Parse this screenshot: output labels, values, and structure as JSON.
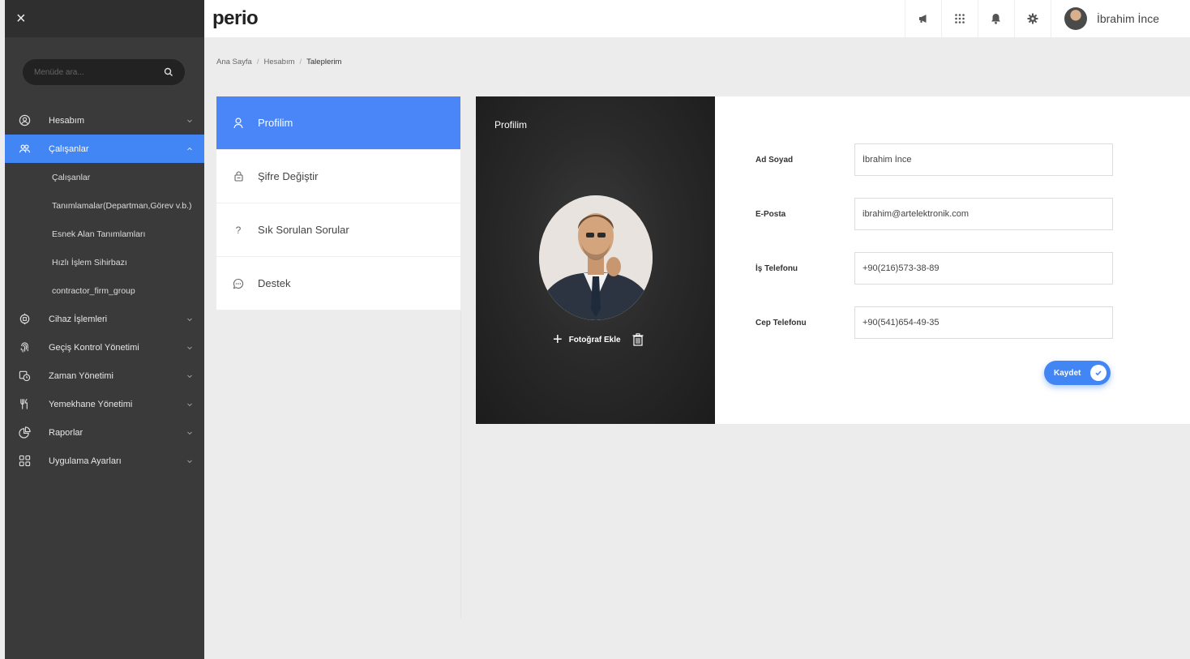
{
  "app": {
    "logo": "perio"
  },
  "header": {
    "user_name": "İbrahim İnce"
  },
  "sidebar": {
    "search_placeholder": "Menüde ara...",
    "menu": [
      {
        "label": "Hesabım",
        "icon": "user-circle-icon",
        "active": false
      },
      {
        "label": "Çalışanlar",
        "icon": "users-icon",
        "active": true,
        "children": [
          "Çalışanlar",
          "Tanımlamalar(Departman,Görev v.b.)",
          "Esnek Alan Tanımlamları",
          "Hızlı İşlem Sihirbazı",
          "contractor_firm_group"
        ]
      },
      {
        "label": "Cihaz İşlemleri",
        "icon": "device-icon"
      },
      {
        "label": "Geçiş Kontrol Yönetimi",
        "icon": "fingerprint-icon"
      },
      {
        "label": "Zaman Yönetimi",
        "icon": "clock-icon"
      },
      {
        "label": "Yemekhane Yönetimi",
        "icon": "fork-knife-icon"
      },
      {
        "label": "Raporlar",
        "icon": "pie-chart-icon"
      },
      {
        "label": "Uygulama Ayarları",
        "icon": "grid-icon"
      }
    ]
  },
  "breadcrumb": [
    "Ana Sayfa",
    "Hesabım",
    "Taleplerim"
  ],
  "account_nav": [
    "Profilim",
    "Şifre Değiştir",
    "Sık Sorulan Sorular",
    "Destek"
  ],
  "photo_panel": {
    "title": "Profilim",
    "add_photo": "Fotoğraf Ekle"
  },
  "form": {
    "fields": [
      {
        "label": "Ad Soyad",
        "value": "İbrahim İnce"
      },
      {
        "label": "E-Posta",
        "value": "ibrahim@artelektronik.com"
      },
      {
        "label": "İş Telefonu",
        "value": "+90(216)573-38-89"
      },
      {
        "label": "Cep Telefonu",
        "value": "+90(541)654-49-35"
      }
    ],
    "save_label": "Kaydet"
  },
  "colors": {
    "accent": "#4285f4",
    "sidebar": "#3a3a3a"
  }
}
